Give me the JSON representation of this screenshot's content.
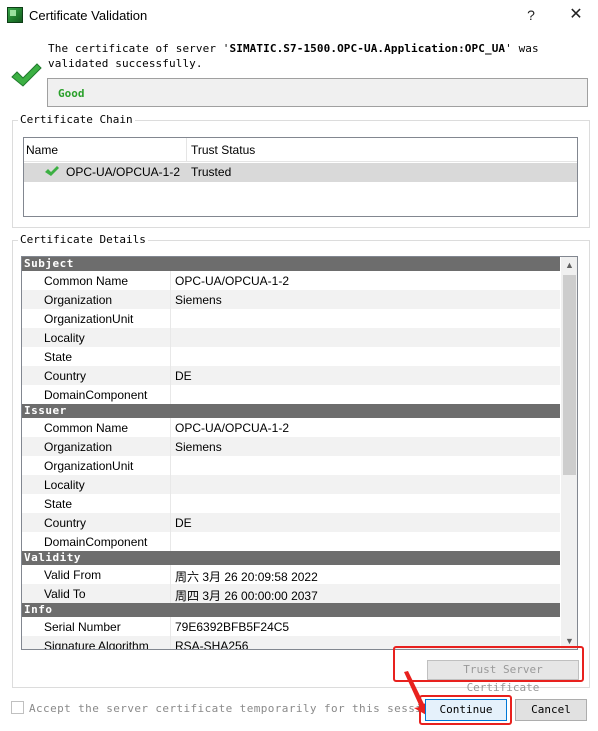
{
  "window": {
    "title": "Certificate Validation",
    "help_glyph": "?",
    "close_glyph": "✕"
  },
  "status": {
    "message_prefix": "The certificate of server '",
    "server_name": "SIMATIC.S7-1500.OPC-UA.Application:OPC_UA",
    "message_suffix": "' was validated successfully.",
    "result": "Good",
    "result_color": "#2aa02a"
  },
  "chain": {
    "group_label": "Certificate Chain",
    "columns": [
      "Name",
      "Trust Status"
    ],
    "rows": [
      {
        "name": "OPC-UA/OPCUA-1-2",
        "status": "Trusted",
        "icon": "check-icon"
      }
    ]
  },
  "details": {
    "group_label": "Certificate Details",
    "sections": [
      {
        "title": "Subject",
        "rows": [
          {
            "key": "Common Name",
            "value": "OPC-UA/OPCUA-1-2"
          },
          {
            "key": "Organization",
            "value": "Siemens"
          },
          {
            "key": "OrganizationUnit",
            "value": ""
          },
          {
            "key": "Locality",
            "value": ""
          },
          {
            "key": "State",
            "value": ""
          },
          {
            "key": "Country",
            "value": "DE"
          },
          {
            "key": "DomainComponent",
            "value": ""
          }
        ]
      },
      {
        "title": "Issuer",
        "rows": [
          {
            "key": "Common Name",
            "value": "OPC-UA/OPCUA-1-2"
          },
          {
            "key": "Organization",
            "value": "Siemens"
          },
          {
            "key": "OrganizationUnit",
            "value": ""
          },
          {
            "key": "Locality",
            "value": ""
          },
          {
            "key": "State",
            "value": ""
          },
          {
            "key": "Country",
            "value": "DE"
          },
          {
            "key": "DomainComponent",
            "value": ""
          }
        ]
      },
      {
        "title": "Validity",
        "rows": [
          {
            "key": "Valid From",
            "value": "周六 3月 26 20:09:58 2022"
          },
          {
            "key": "Valid To",
            "value": "周四 3月 26 00:00:00 2037"
          }
        ]
      },
      {
        "title": "Info",
        "rows": [
          {
            "key": "Serial Number",
            "value": "79E6392BFB5F24C5"
          },
          {
            "key": "Signature Algorithm",
            "value": "RSA-SHA256"
          }
        ]
      }
    ]
  },
  "actions": {
    "trust_label": "Trust Server Certificate",
    "accept_label": "Accept the server certificate temporarily for this session",
    "continue_label": "Continue",
    "cancel_label": "Cancel"
  },
  "highlight_color": "#e8211e"
}
